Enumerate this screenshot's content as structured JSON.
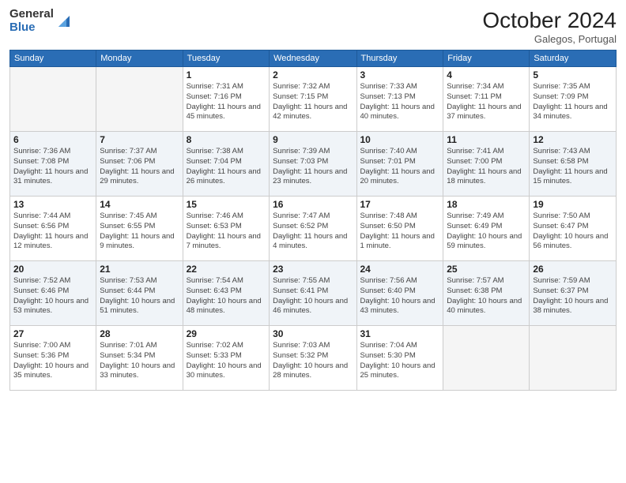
{
  "header": {
    "logo_general": "General",
    "logo_blue": "Blue",
    "month_title": "October 2024",
    "location": "Galegos, Portugal"
  },
  "days_of_week": [
    "Sunday",
    "Monday",
    "Tuesday",
    "Wednesday",
    "Thursday",
    "Friday",
    "Saturday"
  ],
  "weeks": [
    [
      {
        "day": "",
        "info": ""
      },
      {
        "day": "",
        "info": ""
      },
      {
        "day": "1",
        "info": "Sunrise: 7:31 AM\nSunset: 7:16 PM\nDaylight: 11 hours and 45 minutes."
      },
      {
        "day": "2",
        "info": "Sunrise: 7:32 AM\nSunset: 7:15 PM\nDaylight: 11 hours and 42 minutes."
      },
      {
        "day": "3",
        "info": "Sunrise: 7:33 AM\nSunset: 7:13 PM\nDaylight: 11 hours and 40 minutes."
      },
      {
        "day": "4",
        "info": "Sunrise: 7:34 AM\nSunset: 7:11 PM\nDaylight: 11 hours and 37 minutes."
      },
      {
        "day": "5",
        "info": "Sunrise: 7:35 AM\nSunset: 7:09 PM\nDaylight: 11 hours and 34 minutes."
      }
    ],
    [
      {
        "day": "6",
        "info": "Sunrise: 7:36 AM\nSunset: 7:08 PM\nDaylight: 11 hours and 31 minutes."
      },
      {
        "day": "7",
        "info": "Sunrise: 7:37 AM\nSunset: 7:06 PM\nDaylight: 11 hours and 29 minutes."
      },
      {
        "day": "8",
        "info": "Sunrise: 7:38 AM\nSunset: 7:04 PM\nDaylight: 11 hours and 26 minutes."
      },
      {
        "day": "9",
        "info": "Sunrise: 7:39 AM\nSunset: 7:03 PM\nDaylight: 11 hours and 23 minutes."
      },
      {
        "day": "10",
        "info": "Sunrise: 7:40 AM\nSunset: 7:01 PM\nDaylight: 11 hours and 20 minutes."
      },
      {
        "day": "11",
        "info": "Sunrise: 7:41 AM\nSunset: 7:00 PM\nDaylight: 11 hours and 18 minutes."
      },
      {
        "day": "12",
        "info": "Sunrise: 7:43 AM\nSunset: 6:58 PM\nDaylight: 11 hours and 15 minutes."
      }
    ],
    [
      {
        "day": "13",
        "info": "Sunrise: 7:44 AM\nSunset: 6:56 PM\nDaylight: 11 hours and 12 minutes."
      },
      {
        "day": "14",
        "info": "Sunrise: 7:45 AM\nSunset: 6:55 PM\nDaylight: 11 hours and 9 minutes."
      },
      {
        "day": "15",
        "info": "Sunrise: 7:46 AM\nSunset: 6:53 PM\nDaylight: 11 hours and 7 minutes."
      },
      {
        "day": "16",
        "info": "Sunrise: 7:47 AM\nSunset: 6:52 PM\nDaylight: 11 hours and 4 minutes."
      },
      {
        "day": "17",
        "info": "Sunrise: 7:48 AM\nSunset: 6:50 PM\nDaylight: 11 hours and 1 minute."
      },
      {
        "day": "18",
        "info": "Sunrise: 7:49 AM\nSunset: 6:49 PM\nDaylight: 10 hours and 59 minutes."
      },
      {
        "day": "19",
        "info": "Sunrise: 7:50 AM\nSunset: 6:47 PM\nDaylight: 10 hours and 56 minutes."
      }
    ],
    [
      {
        "day": "20",
        "info": "Sunrise: 7:52 AM\nSunset: 6:46 PM\nDaylight: 10 hours and 53 minutes."
      },
      {
        "day": "21",
        "info": "Sunrise: 7:53 AM\nSunset: 6:44 PM\nDaylight: 10 hours and 51 minutes."
      },
      {
        "day": "22",
        "info": "Sunrise: 7:54 AM\nSunset: 6:43 PM\nDaylight: 10 hours and 48 minutes."
      },
      {
        "day": "23",
        "info": "Sunrise: 7:55 AM\nSunset: 6:41 PM\nDaylight: 10 hours and 46 minutes."
      },
      {
        "day": "24",
        "info": "Sunrise: 7:56 AM\nSunset: 6:40 PM\nDaylight: 10 hours and 43 minutes."
      },
      {
        "day": "25",
        "info": "Sunrise: 7:57 AM\nSunset: 6:38 PM\nDaylight: 10 hours and 40 minutes."
      },
      {
        "day": "26",
        "info": "Sunrise: 7:59 AM\nSunset: 6:37 PM\nDaylight: 10 hours and 38 minutes."
      }
    ],
    [
      {
        "day": "27",
        "info": "Sunrise: 7:00 AM\nSunset: 5:36 PM\nDaylight: 10 hours and 35 minutes."
      },
      {
        "day": "28",
        "info": "Sunrise: 7:01 AM\nSunset: 5:34 PM\nDaylight: 10 hours and 33 minutes."
      },
      {
        "day": "29",
        "info": "Sunrise: 7:02 AM\nSunset: 5:33 PM\nDaylight: 10 hours and 30 minutes."
      },
      {
        "day": "30",
        "info": "Sunrise: 7:03 AM\nSunset: 5:32 PM\nDaylight: 10 hours and 28 minutes."
      },
      {
        "day": "31",
        "info": "Sunrise: 7:04 AM\nSunset: 5:30 PM\nDaylight: 10 hours and 25 minutes."
      },
      {
        "day": "",
        "info": ""
      },
      {
        "day": "",
        "info": ""
      }
    ]
  ]
}
